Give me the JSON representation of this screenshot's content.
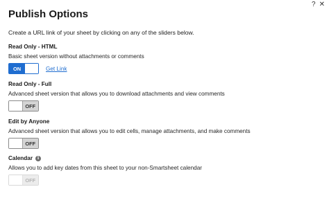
{
  "dialog": {
    "title": "Publish Options",
    "help_icon": "?",
    "close_icon": "✕",
    "intro": "Create a URL link of your sheet by clicking on any of the sliders below."
  },
  "options": [
    {
      "title": "Read Only - HTML",
      "description": "Basic sheet version without attachments or comments",
      "toggle": "ON",
      "enabled": true,
      "link": "Get Link"
    },
    {
      "title": "Read Only - Full",
      "description": "Advanced sheet version that allows you to download attachments and view comments",
      "toggle": "OFF",
      "enabled": true
    },
    {
      "title": "Edit by Anyone",
      "description": "Advanced sheet version that allows you to edit cells, manage attachments, and make comments",
      "toggle": "OFF",
      "enabled": true
    },
    {
      "title": "Calendar",
      "description": "Allows you to add key dates from this sheet to your non-Smartsheet calendar",
      "toggle": "OFF",
      "enabled": false,
      "info_icon": "i"
    }
  ],
  "colors": {
    "accent": "#1f6dd0",
    "off_state": "#d4d4d4"
  }
}
